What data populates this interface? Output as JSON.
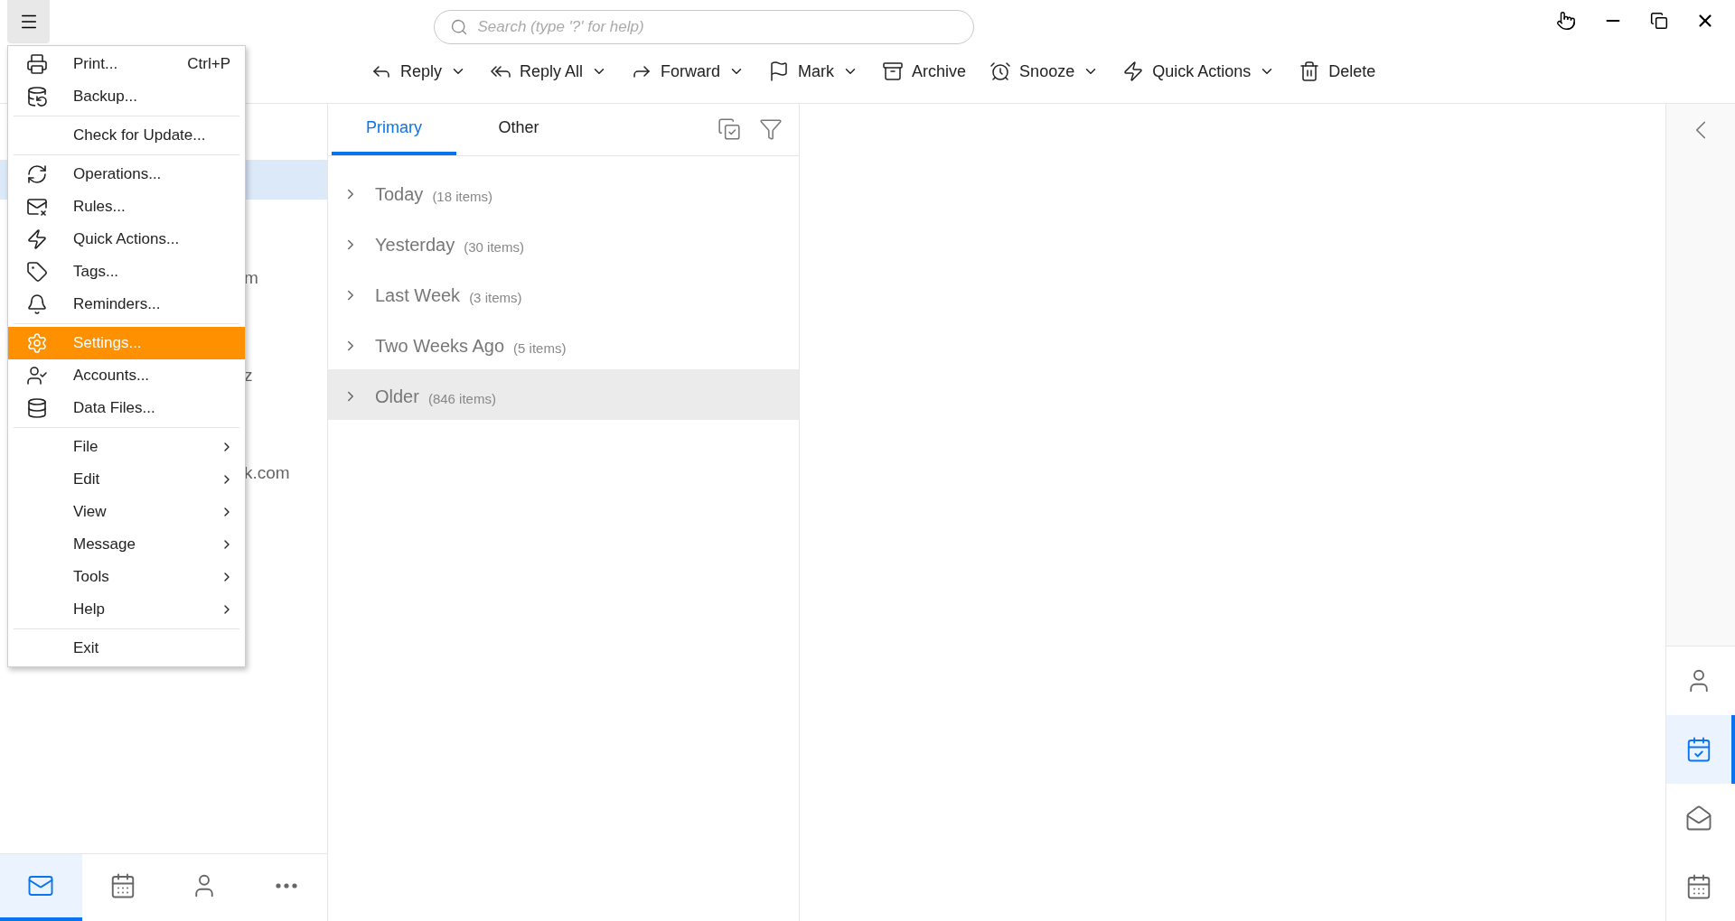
{
  "search": {
    "placeholder": "Search (type '?' for help)"
  },
  "toolbar": [
    {
      "label": "Reply",
      "dropdown": true
    },
    {
      "label": "Reply All",
      "dropdown": true
    },
    {
      "label": "Forward",
      "dropdown": true
    },
    {
      "label": "Mark",
      "dropdown": true
    },
    {
      "label": "Archive",
      "dropdown": false
    },
    {
      "label": "Snooze",
      "dropdown": true
    },
    {
      "label": "Quick Actions",
      "dropdown": true
    },
    {
      "label": "Delete",
      "dropdown": false
    }
  ],
  "sidebar": {
    "items": [
      {
        "selected": true
      },
      {
        "visible_text": "m",
        "selected": false
      },
      {
        "visible_text": "z",
        "selected": false
      },
      {
        "visible_text": "k.com",
        "selected": false
      }
    ]
  },
  "bottom_nav": [
    {
      "selected": true
    },
    {
      "selected": false
    },
    {
      "selected": false
    },
    {
      "selected": false
    }
  ],
  "tabs": [
    {
      "label": "Primary",
      "selected": true
    },
    {
      "label": "Other",
      "selected": false
    }
  ],
  "groups": [
    {
      "label": "Today",
      "count": "(18 items)",
      "selected": false
    },
    {
      "label": "Yesterday",
      "count": "(30 items)",
      "selected": false
    },
    {
      "label": "Last Week",
      "count": "(3 items)",
      "selected": false
    },
    {
      "label": "Two Weeks Ago",
      "count": "(5 items)",
      "selected": false
    },
    {
      "label": "Older",
      "count": "(846 items)",
      "selected": true
    }
  ],
  "right_rail": [
    {
      "selected": false
    },
    {
      "selected": true
    },
    {
      "selected": false
    },
    {
      "selected": false
    }
  ],
  "menu": {
    "groups": [
      [
        {
          "kind": "icon",
          "label": "Print...",
          "shortcut": "Ctrl+P",
          "selected": false
        },
        {
          "kind": "icon",
          "label": "Backup...",
          "selected": false
        }
      ],
      [
        {
          "kind": "plain",
          "label": "Check for Update...",
          "selected": false
        }
      ],
      [
        {
          "kind": "icon",
          "label": "Operations...",
          "selected": false
        },
        {
          "kind": "icon",
          "label": "Rules...",
          "selected": false
        },
        {
          "kind": "icon",
          "label": "Quick Actions...",
          "selected": false
        },
        {
          "kind": "icon",
          "label": "Tags...",
          "selected": false
        },
        {
          "kind": "icon",
          "label": "Reminders...",
          "selected": false
        }
      ],
      [
        {
          "kind": "icon",
          "label": "Settings...",
          "selected": true
        },
        {
          "kind": "icon",
          "label": "Accounts...",
          "selected": false
        },
        {
          "kind": "icon",
          "label": "Data Files...",
          "selected": false
        }
      ],
      [
        {
          "kind": "submenu",
          "label": "File",
          "selected": false
        },
        {
          "kind": "submenu",
          "label": "Edit",
          "selected": false
        },
        {
          "kind": "submenu",
          "label": "View",
          "selected": false
        },
        {
          "kind": "submenu",
          "label": "Message",
          "selected": false
        },
        {
          "kind": "submenu",
          "label": "Tools",
          "selected": false
        },
        {
          "kind": "submenu",
          "label": "Help",
          "selected": false
        }
      ],
      [
        {
          "kind": "plain",
          "label": "Exit",
          "selected": false
        }
      ]
    ]
  }
}
